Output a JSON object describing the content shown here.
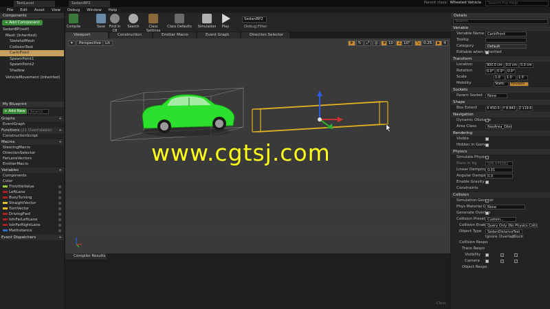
{
  "window": {
    "tabs": [
      "TestLevel",
      "SedanBP2"
    ],
    "parent_class_label": "Parent class:",
    "parent_class_value": "Wheeled Vehicle",
    "search_help_placeholder": "Search For Help"
  },
  "menu": [
    "File",
    "Edit",
    "Asset",
    "View",
    "Debug",
    "Window",
    "Help"
  ],
  "toolbar": {
    "compile": "Compile",
    "save": "Save",
    "find_in_cb": "Find in CB",
    "search": "Search",
    "class_settings": "Class Settings",
    "class_defaults": "Class Defaults",
    "simulation": "Simulation",
    "play": "Play",
    "debug_filter_value": "SedanBP2",
    "debug_filter_label": "Debug Filter"
  },
  "components_panel": {
    "title": "Components",
    "add_button": "+ Add Component",
    "search_placeholder": "Search",
    "items": [
      "SedanBP(self)",
      "Mesh (Inherited)",
      "SkeletalMesh",
      "CollisionTest",
      "CarInFront",
      "SpawnPoint1",
      "SpawnPoint2",
      "Shadow",
      "VehicleMovement (Inherited)"
    ],
    "selected_index": 4
  },
  "my_blueprint": {
    "title": "My Blueprint",
    "add_new": "+ Add New",
    "search_placeholder": "Search",
    "graphs_label": "Graphs",
    "graphs": [
      "EventGraph"
    ],
    "functions_label": "Functions",
    "functions_overridable": "(21 Overridable)",
    "functions": [
      "ConstructionScript"
    ],
    "macros_label": "Macros",
    "macros": [
      "SteeringMacro",
      "DirectionSelector",
      "FarLaneVectors",
      "EmitterMacro"
    ],
    "variables_label": "Variables",
    "var_groups": [
      "Components",
      "Color"
    ],
    "variables": [
      {
        "name": "ThrottleValue",
        "color": "#9acd32"
      },
      {
        "name": "LeftLane",
        "color": "#b02020"
      },
      {
        "name": "BusyTurning",
        "color": "#b02020"
      },
      {
        "name": "StraightVector",
        "color": "#e0c020"
      },
      {
        "name": "TurnVector",
        "color": "#e0c020"
      },
      {
        "name": "DrivingFwd",
        "color": "#b02020"
      },
      {
        "name": "IsInFarLeftLane",
        "color": "#b02020"
      },
      {
        "name": "IsInFarRightLane",
        "color": "#b02020"
      },
      {
        "name": "MatInstance",
        "color": "#3a6ad0"
      }
    ],
    "event_dispatchers_label": "Event Dispatchers"
  },
  "doc_tabs": [
    "Viewport",
    "Construction Script",
    "Emitter Macro",
    "Event Graph",
    "Direction Selector"
  ],
  "viewport": {
    "perspective": "Perspective",
    "lit": "Lit",
    "snap_values": [
      "10",
      "10°",
      "0.25",
      "4"
    ],
    "watermark": "www.cgtsj.com"
  },
  "compiler": {
    "tab": "Compiler Results",
    "clear": "Clear"
  },
  "details": {
    "title": "Details",
    "search_placeholder": "Search",
    "variable_section": "Variable",
    "variable_name_label": "Variable Name",
    "variable_name_value": "CarInFront",
    "tooltip_label": "Tooltip",
    "category_label": "Category",
    "category_value": "Default",
    "editable_label": "Editable when Inherited",
    "transform_section": "Transform",
    "location_label": "Location",
    "location": [
      "900.0 cm",
      "0.0 cm",
      "0.0 cm"
    ],
    "rotation_label": "Rotation",
    "rotation": [
      "0.0°",
      "0.0°",
      "0.0°"
    ],
    "scale_label": "Scale",
    "scale": [
      "1.0",
      "1.0",
      "1.0"
    ],
    "mobility_label": "Mobility",
    "mobility_static": "Static",
    "mobility_movable": "Movable",
    "sockets_section": "Sockets",
    "parent_socket_label": "Parent Socket",
    "parent_socket_value": "None",
    "shape_section": "Shape",
    "box_extent_label": "Box Extent",
    "box_extent": [
      "X 450.0",
      "Y 8.843",
      "Z 119.6"
    ],
    "navigation_section": "Navigation",
    "dynamic_obstacle_label": "Dynamic Obstacle",
    "area_class_label": "Area Class",
    "area_class_value": "NavArea_Obst",
    "rendering_section": "Rendering",
    "visible_label": "Visible",
    "hidden_in_game_label": "Hidden in Game",
    "physics_section": "Physics",
    "simulate_physics_label": "Simulate Physics",
    "mass_label": "Mass in Kg",
    "mass_value": "506.070282",
    "linear_damping_label": "Linear Damping",
    "linear_damping_value": "0.01",
    "angular_damping_label": "Angular Damping",
    "angular_damping_value": "0.0",
    "enable_gravity_label": "Enable Gravity",
    "constraints_label": "Constraints",
    "collision_section": "Collision",
    "sim_gen_label": "Simulation Generat",
    "phys_mat_label": "Phys Material Over",
    "phys_mat_value": "None",
    "gen_overlap_label": "Generate Overlap",
    "collision_presets_label": "Collision Presets",
    "collision_presets_value": "Custom...",
    "collision_enabled_label": "Collision Enabled",
    "collision_enabled_value": "Query Only (No Physics Collision)",
    "object_type_label": "Object Type",
    "object_type_value": "SedanDistanceTest",
    "resp_ignore": "Ignore",
    "resp_overlap": "Overlap",
    "resp_block": "Block",
    "collision_resp_label": "Collision Respo",
    "trace_resp_label": "Trace Respo",
    "visibility_label": "Visibility",
    "camera_label": "Camera",
    "object_resp_label": "Object Respo"
  }
}
